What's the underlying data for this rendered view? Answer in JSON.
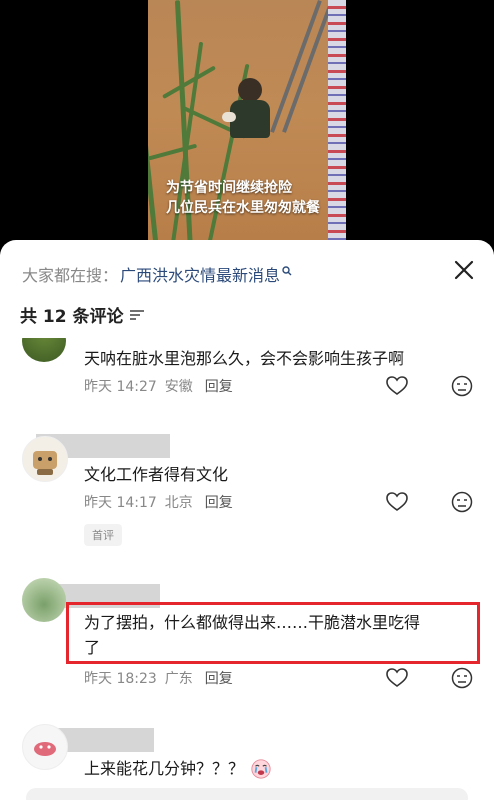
{
  "video": {
    "caption_line1": "为节省时间继续抢险",
    "caption_line2": "几位民兵在水里匆匆就餐"
  },
  "sheet": {
    "search_prefix": "大家都在搜：",
    "search_query": "广西洪水灾情最新消息",
    "comment_count_label": "共 12 条评论"
  },
  "comments": [
    {
      "text": "天呐在脏水里泡那么久，会不会影响生孩子啊",
      "time": "昨天 14:27",
      "location": "安徽",
      "reply": "回复"
    },
    {
      "text": "文化工作者得有文化",
      "time": "昨天 14:17",
      "location": "北京",
      "reply": "回复",
      "badge": "首评"
    },
    {
      "text_line1": "为了摆拍，什么都做得出来……干脆潜水里吃得",
      "text_line2": "了",
      "time": "昨天 18:23",
      "location": "广东",
      "reply": "回复"
    },
    {
      "text": "上来能花几分钟？？？",
      "emoji": "crying-face"
    }
  ],
  "colors": {
    "highlight": "#e5262c",
    "link": "#2b4a7a",
    "meta": "#888888"
  }
}
